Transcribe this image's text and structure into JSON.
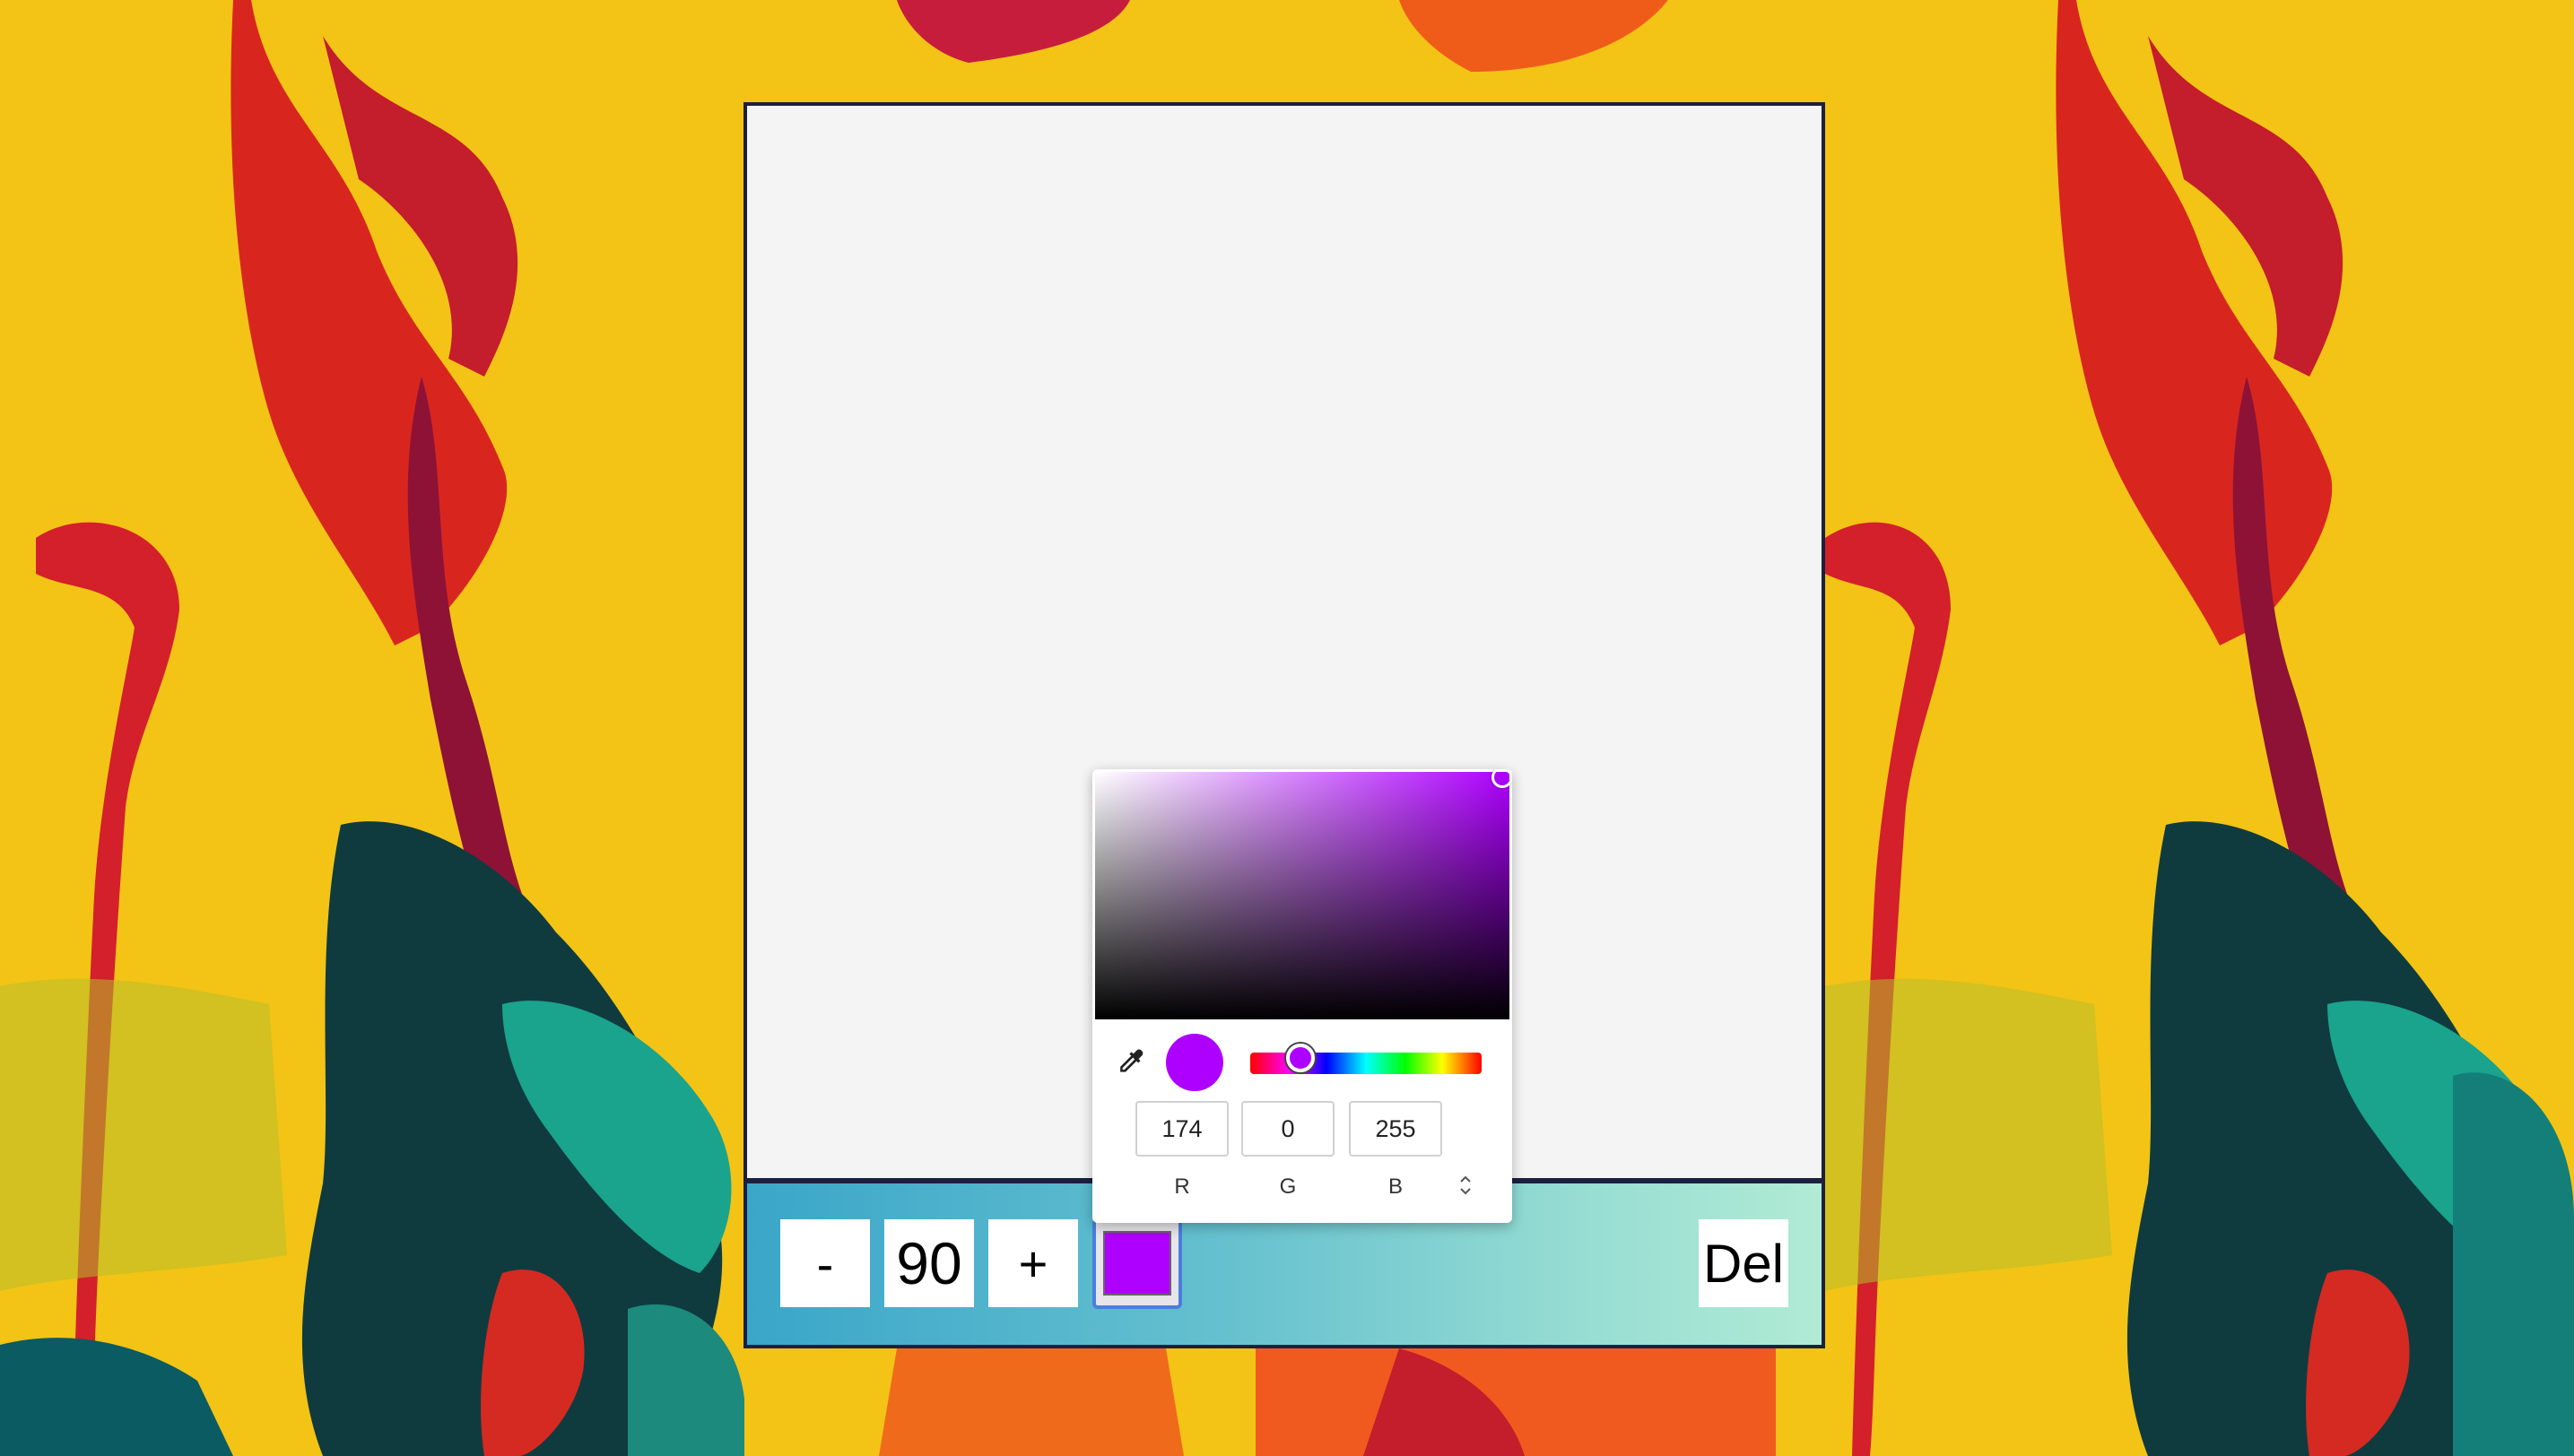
{
  "toolbar": {
    "decrease_label": "-",
    "brush_size": "90",
    "increase_label": "+",
    "current_color": "#ae00ff",
    "delete_label": "Del"
  },
  "color_picker": {
    "selected_color": "#ae00ff",
    "hue_color": "#ae00ff",
    "r_value": "174",
    "g_value": "0",
    "b_value": "255",
    "r_label": "R",
    "g_label": "G",
    "b_label": "B",
    "mode_toggle_icon": "up-down-chevron-icon",
    "eyedropper_icon": "eyedropper-icon"
  },
  "colors": {
    "panel_border": "#1c1f3f",
    "canvas_bg": "#f4f4f4",
    "toolbar_gradient_start": "#3aa6c9",
    "toolbar_gradient_end": "#b0ebd5",
    "accent_border": "#4c7edc"
  }
}
